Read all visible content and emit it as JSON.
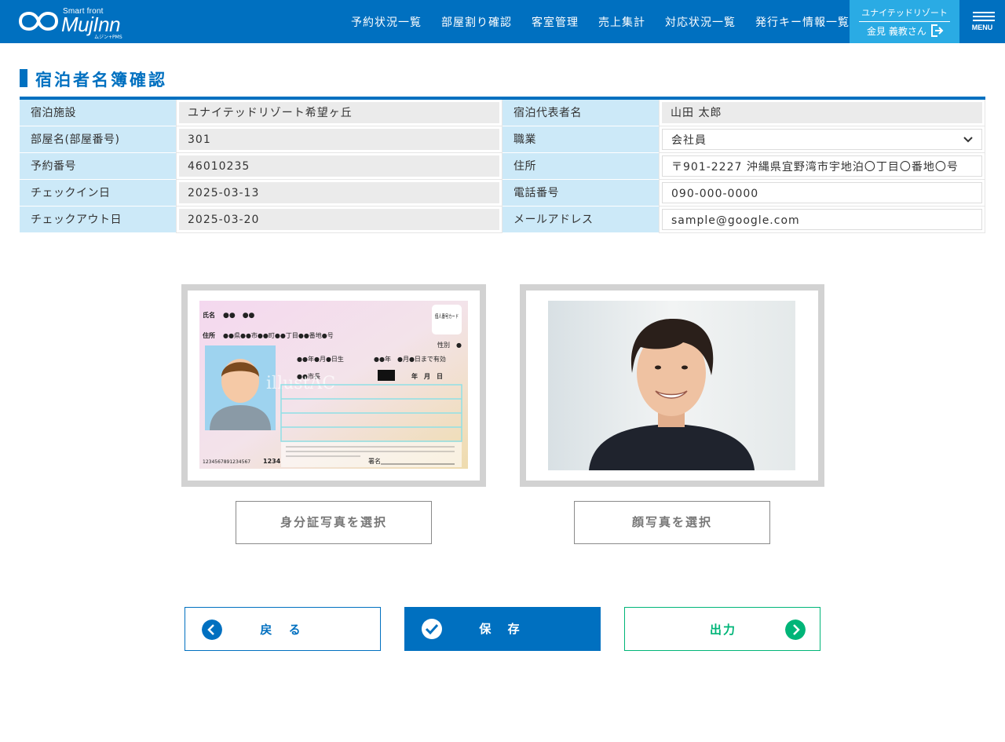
{
  "header": {
    "logo_small": "Smart front",
    "logo_main": "MujInn",
    "logo_sub": "ムジン+PMS",
    "nav": [
      "予約状況一覧",
      "部屋割り確認",
      "客室管理",
      "売上集計",
      "対応状況一覧",
      "発行キー情報一覧"
    ],
    "user_company": "ユナイテッドリゾート",
    "user_name": "金見 義教さん",
    "menu_label": "MENU"
  },
  "page": {
    "title": "宿泊者名簿確認"
  },
  "info": {
    "left": [
      {
        "label": "宿泊施設",
        "value": "ユナイテッドリゾート希望ヶ丘"
      },
      {
        "label": "部屋名(部屋番号)",
        "value": "301"
      },
      {
        "label": "予約番号",
        "value": "46010235"
      },
      {
        "label": "チェックイン日",
        "value": "2025-03-13"
      },
      {
        "label": "チェックアウト日",
        "value": "2025-03-20"
      }
    ],
    "right": [
      {
        "label": "宿泊代表者名",
        "value": "山田 太郎"
      },
      {
        "label": "職業",
        "value": "会社員"
      },
      {
        "label": "住所",
        "value": "〒901-2227 沖縄県宜野湾市宇地泊〇丁目〇番地〇号"
      },
      {
        "label": "電話番号",
        "value": "090-000-0000"
      },
      {
        "label": "メールアドレス",
        "value": "sample@google.com"
      }
    ]
  },
  "idcard": {
    "name_label": "氏名",
    "name_value": "●●　●●",
    "addr_label": "住所",
    "addr_value": "●●県●●市●●町●●丁目●●番地●号",
    "badge": "個人番号カード",
    "gender": "性別　●",
    "birth": "●●年●月●日生",
    "valid": "●●年　●月●日まで有効",
    "mayor": "●●市長",
    "ymd": "年　月　日",
    "number": "1234567891234567",
    "pin": "1234",
    "sign": "署名",
    "watermark": "illustAC"
  },
  "photos": {
    "id_button": "身分証写真を選択",
    "face_button": "顔写真を選択"
  },
  "buttons": {
    "back": "戻 る",
    "save": "保 存",
    "output": "出力"
  },
  "colors": {
    "primary": "#0070c0",
    "accent": "#2aabe4",
    "label_bg": "#cce9f8",
    "output_green": "#00b578"
  }
}
